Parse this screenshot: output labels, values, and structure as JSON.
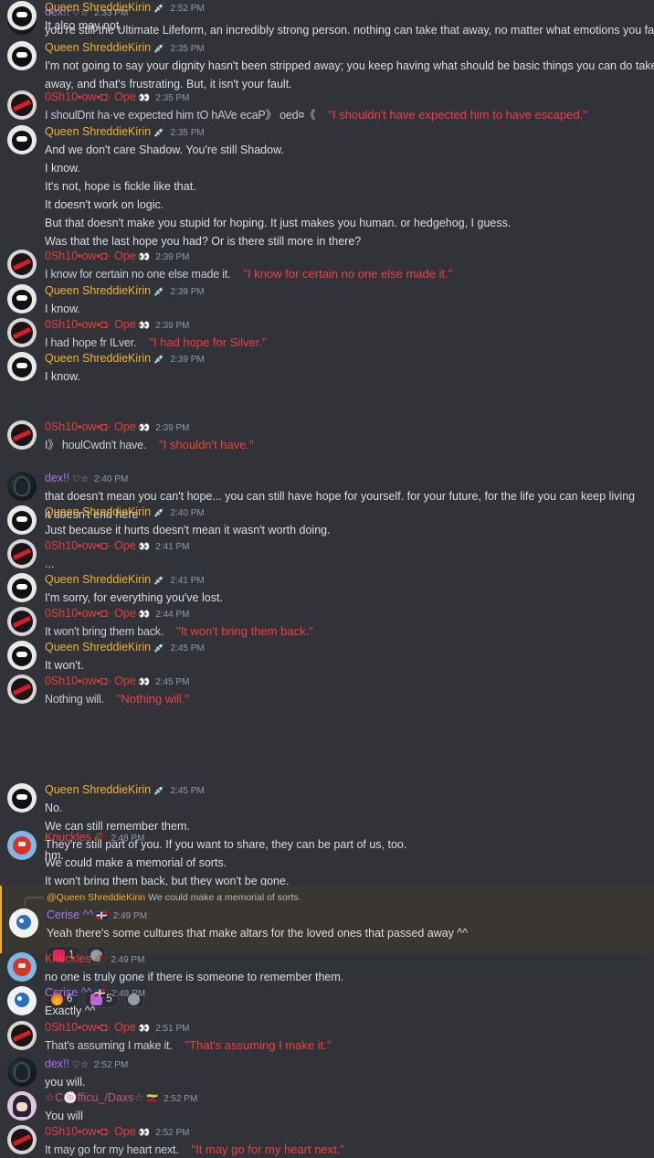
{
  "users": {
    "dex": {
      "name": "dex!!",
      "badge": "♡☆"
    },
    "queen": {
      "name": "Queen ShreddieKirin",
      "badge": "💉"
    },
    "shadow": {
      "name": "0Sh10▪ow▪◘· Ope",
      "badge": "👀"
    },
    "knuckles": {
      "name": "Knuckles",
      "badge": "🥀"
    },
    "cerise": {
      "name": "Cerise ^^",
      "badge": "🇩🇴"
    },
    "daxs": {
      "name": "☆C🍥fficu_/Daxs☆",
      "badge": "🇻🇪"
    }
  },
  "messages": [
    {
      "user": "dex",
      "time": "2:33 PM",
      "lines": [
        "you're still the Ultimate Lifeform, an incredibly strong person. nothing can take that away, no matter what emotions you face"
      ]
    },
    {
      "user": "queen",
      "time": "2:35 PM",
      "lines": [
        "I'm not going to say your dignity hasn't been stripped away; you keep having what should be basic things you can do taken",
        "away, and that's frustrating. But, it isn't your fault."
      ]
    },
    {
      "user": "shadow",
      "time": "2:35 PM",
      "glitch": "I shoulDnt ha·ve expected him tO hAVe ecaP》 oed¤《",
      "translation": "\"I shouldn't have expected him to have escaped.\""
    },
    {
      "user": "queen",
      "time": "2:35 PM",
      "lines": [
        "And we don't care Shadow. You're still Shadow.",
        "I know.",
        "It's not, hope is fickle like that.",
        "It doesn't work on logic.",
        "But that doesn't make you stupid for hoping. It just makes you human. or hedgehog, I guess.",
        "Was that the last hope you had? Or is there still more in there?"
      ]
    },
    {
      "user": "shadow",
      "time": "2:39 PM",
      "glitch": "I know for certain no one else made it.",
      "translation": "\"I know for certain no one else made it.\""
    },
    {
      "user": "queen",
      "time": "2:39 PM",
      "lines": [
        "I know."
      ]
    },
    {
      "user": "shadow",
      "time": "2:39 PM",
      "glitch": "I had hope fr ILver.",
      "translation": "\"I had hope for Silver.\""
    },
    {
      "user": "queen",
      "time": "2:39 PM",
      "lines": [
        "I know."
      ]
    },
    {
      "user": "shadow",
      "time": "2:39 PM",
      "glitch": "I》 houlCwdn't have.",
      "translation": "\"I shouldn't have.\""
    },
    {
      "user": "dex",
      "time": "2:40 PM",
      "lines": [
        "that doesn't mean you can't hope... you can still have hope for yourself. for your future, for the life you can keep living",
        "it doesn't end here"
      ]
    },
    {
      "user": "queen",
      "time": "2:40 PM",
      "lines": [
        "Just because it hurts doesn't mean it wasn't worth doing."
      ]
    },
    {
      "user": "shadow",
      "time": "2:41 PM",
      "lines": [
        "..."
      ]
    },
    {
      "user": "queen",
      "time": "2:41 PM",
      "lines": [
        "I'm sorry, for everything you've lost."
      ]
    },
    {
      "user": "shadow",
      "time": "2:44 PM",
      "glitch": "It won't bring them back.",
      "translation": "\"It won't bring them back.\""
    },
    {
      "user": "queen",
      "time": "2:45 PM",
      "lines": [
        "It won't."
      ]
    },
    {
      "user": "shadow",
      "time": "2:45 PM",
      "glitch": "Nothing will.",
      "translation": "\"Nothing will.\""
    },
    {
      "user": "queen",
      "time": "2:45 PM",
      "lines": [
        "No.",
        "We can still remember them.",
        "They're still part of you. If you want to share, they can be part of us, too.",
        "We could make a memorial of sorts.",
        "It won't bring them back, but they won't be gone."
      ]
    },
    {
      "user": "knuckles",
      "time": "2:48 PM",
      "lines": [
        "hm."
      ]
    },
    {
      "user": "cerise",
      "time": "2:49 PM",
      "reply": {
        "name": "@Queen ShreddieKirin",
        "text": "We could make a memorial of sorts."
      },
      "lines": [
        "Yeah there's some cultures that make altars for the loved ones that passed away ^^"
      ],
      "reactions": [
        {
          "emoji": "heart",
          "count": "1"
        }
      ]
    },
    {
      "user": "knuckles",
      "time": "2:49 PM",
      "lines": [
        "no one is truly gone if there is someone to remember them."
      ],
      "reactions": [
        {
          "emoji": "fire",
          "count": "6"
        },
        {
          "emoji": "this",
          "count": "5"
        }
      ]
    },
    {
      "user": "cerise",
      "time": "2:49 PM",
      "lines": [
        "Exactly ^^"
      ]
    },
    {
      "user": "shadow",
      "time": "2:51 PM",
      "glitch": "That's assuming I make it.",
      "translation": "\"That's assuming I make it.\""
    },
    {
      "user": "dex",
      "time": "2:52 PM",
      "lines": [
        "you will."
      ]
    },
    {
      "user": "daxs",
      "time": "2:52 PM",
      "lines": [
        "You will"
      ]
    },
    {
      "user": "shadow",
      "time": "2:52 PM",
      "glitch": "It may go for my heart next.",
      "translation": "\"It may go for my heart next.\""
    },
    {
      "user": "queen",
      "time": "2:52 PM",
      "lines": [
        "It also may not."
      ]
    }
  ]
}
